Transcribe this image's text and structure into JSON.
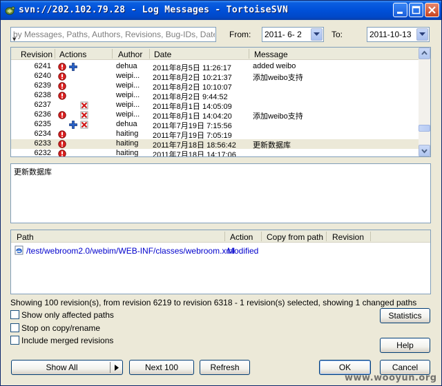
{
  "window": {
    "title": "svn://202.102.79.28 - Log Messages - TortoiseSVN"
  },
  "filter": {
    "placeholder": "by Messages, Paths, Authors, Revisions, Bug-IDs, Date, Date range"
  },
  "dates": {
    "from_label": "From:",
    "from_value": "2011- 6- 2",
    "to_label": "To:",
    "to_value": "2011-10-13"
  },
  "log": {
    "columns": [
      "Revision",
      "Actions",
      "Author",
      "Date",
      "Message"
    ],
    "rows": [
      {
        "rev": "6241",
        "actions": [
          "modified",
          "added"
        ],
        "author": "dehua",
        "date": "2011年8月5日 11:26:17",
        "msg": "added weibo"
      },
      {
        "rev": "6240",
        "actions": [
          "modified"
        ],
        "author": "weipi...",
        "date": "2011年8月2日 10:21:37",
        "msg": "添加weibo支持"
      },
      {
        "rev": "6239",
        "actions": [
          "modified"
        ],
        "author": "weipi...",
        "date": "2011年8月2日 10:10:07",
        "msg": ""
      },
      {
        "rev": "6238",
        "actions": [
          "modified"
        ],
        "author": "weipi...",
        "date": "2011年8月2日 9:44:52",
        "msg": ""
      },
      {
        "rev": "6237",
        "actions": [
          "deleted"
        ],
        "author": "weipi...",
        "date": "2011年8月1日 14:05:09",
        "msg": ""
      },
      {
        "rev": "6236",
        "actions": [
          "modified",
          "deleted"
        ],
        "author": "weipi...",
        "date": "2011年8月1日 14:04:20",
        "msg": "添加weibo支持"
      },
      {
        "rev": "6235",
        "actions": [
          "added",
          "deleted"
        ],
        "author": "dehua",
        "date": "2011年7月19日 7:15:56",
        "msg": ""
      },
      {
        "rev": "6234",
        "actions": [
          "modified"
        ],
        "author": "haiting",
        "date": "2011年7月19日 7:05:19",
        "msg": ""
      },
      {
        "rev": "6233",
        "actions": [
          "modified"
        ],
        "author": "haiting",
        "date": "2011年7月18日 18:56:42",
        "msg": "更新数据库",
        "selected": true
      },
      {
        "rev": "6232",
        "actions": [
          "modified"
        ],
        "author": "haiting",
        "date": "2011年7月18日 14:17:06",
        "msg": ""
      }
    ]
  },
  "message_text": "更新数据库",
  "paths": {
    "columns": [
      "Path",
      "Action",
      "Copy from path",
      "Revision"
    ],
    "rows": [
      {
        "path": "/test/webroom2.0/webim/WEB-INF/classes/webroom.xml",
        "action": "Modified",
        "copy_from": "",
        "revision": ""
      }
    ]
  },
  "status_text": "Showing 100 revision(s), from revision 6219 to revision 6318 - 1 revision(s) selected, showing 1 changed paths",
  "options": {
    "affected_paths": "Show only affected paths",
    "stop_on_copy": "Stop on copy/rename",
    "merged_revisions": "Include merged revisions"
  },
  "buttons": {
    "statistics": "Statistics",
    "help": "Help",
    "show_all": "Show All",
    "next_100": "Next 100",
    "refresh": "Refresh",
    "ok": "OK",
    "cancel": "Cancel"
  },
  "watermark": "www.wooyun.org",
  "colors": {
    "titlebar": "#0050d8",
    "selection_row": "#ece9d8",
    "path_link": "#0000cc"
  }
}
